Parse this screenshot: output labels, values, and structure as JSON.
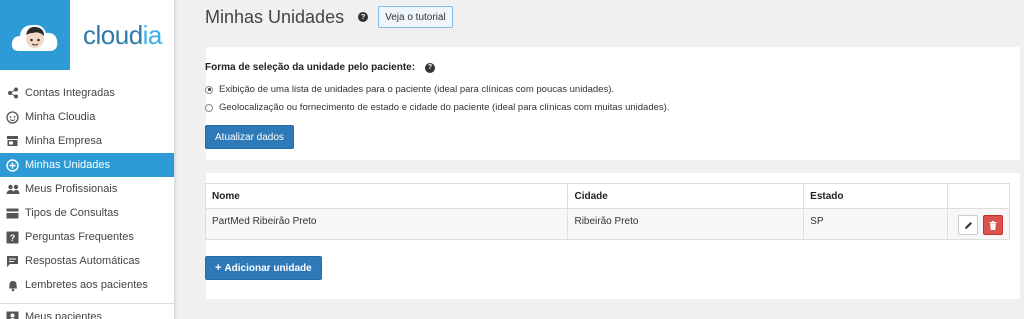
{
  "brand": {
    "name_prefix": "cloud",
    "name_highlight": "ia",
    "accent": "#2e9ad6"
  },
  "sidebar": {
    "items": [
      {
        "label": "Contas Integradas",
        "icon": "share-icon"
      },
      {
        "label": "Minha Cloudia",
        "icon": "face-icon"
      },
      {
        "label": "Minha Empresa",
        "icon": "store-icon"
      },
      {
        "label": "Minhas Unidades",
        "icon": "plus-circle-icon",
        "active": true
      },
      {
        "label": "Meus Profissionais",
        "icon": "people-icon"
      },
      {
        "label": "Tipos de Consultas",
        "icon": "card-icon"
      },
      {
        "label": "Perguntas Frequentes",
        "icon": "question-icon"
      },
      {
        "label": "Respostas Automáticas",
        "icon": "chat-icon"
      },
      {
        "label": "Lembretes aos pacientes",
        "icon": "bell-icon"
      },
      {
        "label": "Meus pacientes",
        "icon": "contact-icon"
      }
    ]
  },
  "header": {
    "title": "Minhas Unidades",
    "tutorial_label": "Veja o tutorial"
  },
  "selection": {
    "label": "Forma de seleção da unidade pelo paciente:",
    "options": [
      {
        "label": "Exibição de uma lista de unidades para o paciente (ideal para clínicas com poucas unidades).",
        "checked": true
      },
      {
        "label": "Geolocalização ou fornecimento de estado e cidade do paciente (ideal para clínicas com muitas unidades).",
        "checked": false
      }
    ],
    "update_label": "Atualizar dados"
  },
  "table": {
    "columns": [
      "Nome",
      "Cidade",
      "Estado"
    ],
    "rows": [
      {
        "nome": "PartMed Ribeirão Preto",
        "cidade": "Ribeirão Preto",
        "estado": "SP"
      }
    ],
    "add_label": "Adicionar unidade",
    "add_prefix": "+"
  }
}
